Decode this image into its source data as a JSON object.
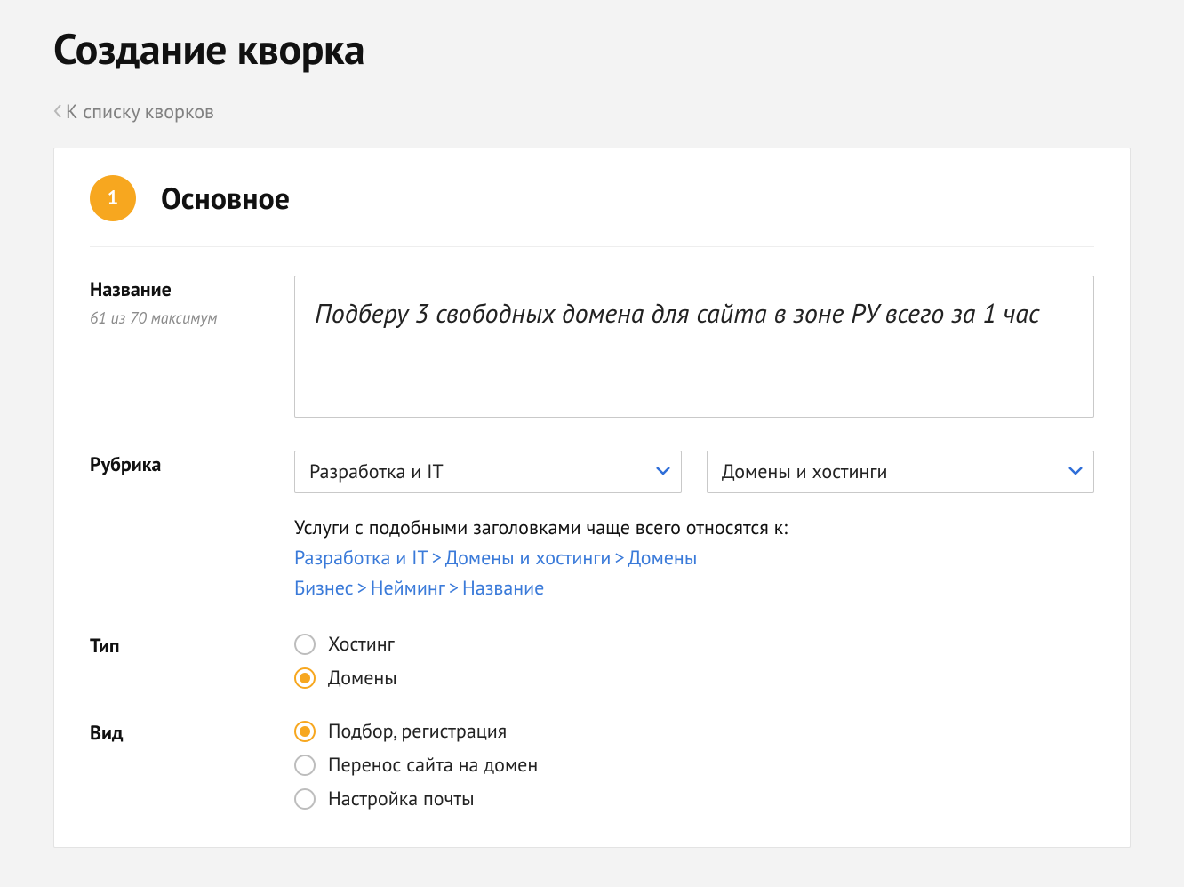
{
  "page": {
    "title": "Создание кворка",
    "back_link": "К списку кворков"
  },
  "section": {
    "step_number": "1",
    "heading": "Основное"
  },
  "fields": {
    "name": {
      "label": "Название",
      "counter": "61 из 70 максимум",
      "value": "Подберу 3 свободных домена для сайта в зоне РУ всего за 1 час"
    },
    "category": {
      "label": "Рубрика",
      "primary_value": "Разработка и IT",
      "secondary_value": "Домены и хостинги",
      "suggestion_intro": "Услуги с подобными заголовками чаще всего относятся к:",
      "suggestions": [
        {
          "parts": [
            "Разработка и IT",
            "Домены и хостинги",
            "Домены"
          ]
        },
        {
          "parts": [
            "Бизнес",
            "Нейминг",
            "Название"
          ]
        }
      ]
    },
    "type": {
      "label": "Тип",
      "options": [
        {
          "label": "Хостинг",
          "checked": false
        },
        {
          "label": "Домены",
          "checked": true
        }
      ]
    },
    "kind": {
      "label": "Вид",
      "options": [
        {
          "label": "Подбор, регистрация",
          "checked": true
        },
        {
          "label": "Перенос сайта на домен",
          "checked": false
        },
        {
          "label": "Настройка почты",
          "checked": false
        }
      ]
    }
  },
  "colors": {
    "accent": "#f7a71f",
    "link": "#3a7ad9",
    "select_chevron": "#2f6ed8"
  }
}
